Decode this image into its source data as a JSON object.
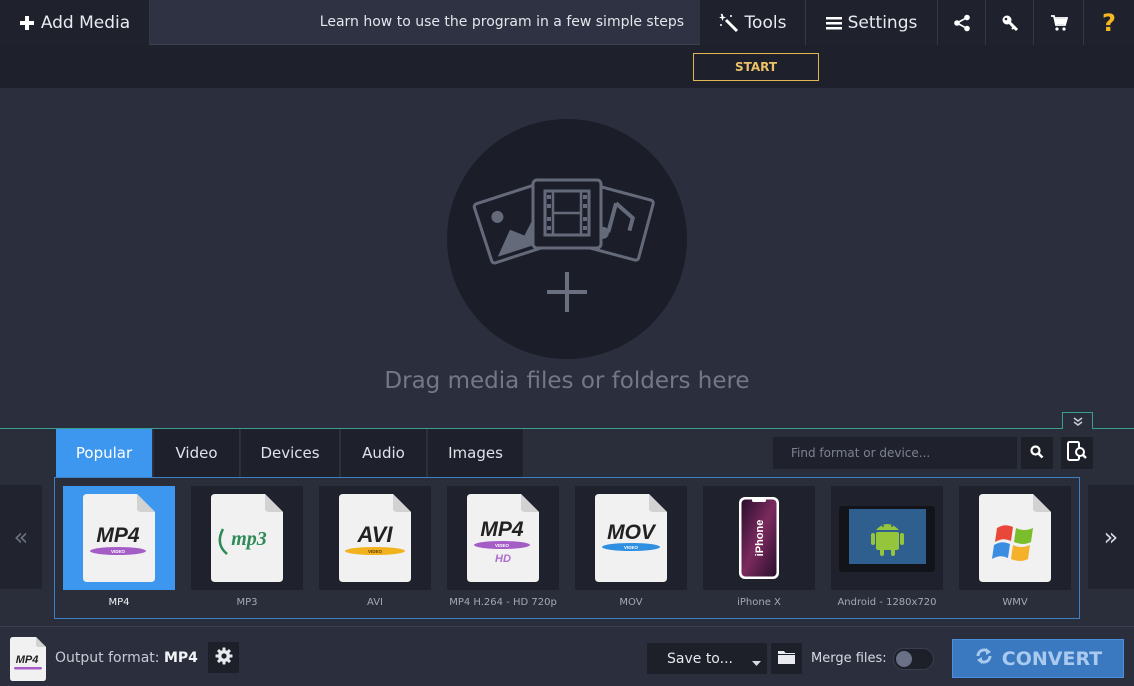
{
  "toolbar": {
    "add_media_label": "Add Media",
    "tools_label": "Tools",
    "settings_label": "Settings",
    "icons": [
      "plus-icon",
      "magic-wand-icon",
      "hamburger-menu-icon",
      "share-icon",
      "key-icon",
      "cart-icon",
      "help-icon"
    ]
  },
  "learn_bar": {
    "text": "Learn how to use the program in a few simple steps",
    "start_label": "START"
  },
  "drop_area": {
    "text": "Drag media files or folders here",
    "icons": [
      "image-icon",
      "film-icon",
      "music-icon",
      "plus-icon"
    ]
  },
  "format_panel": {
    "tabs": [
      {
        "label": "Popular",
        "active": true
      },
      {
        "label": "Video",
        "active": false
      },
      {
        "label": "Devices",
        "active": false
      },
      {
        "label": "Audio",
        "active": false
      },
      {
        "label": "Images",
        "active": false
      }
    ],
    "search": {
      "placeholder": "Find format or device...",
      "value": ""
    },
    "prev_label": "«",
    "next_label": "»",
    "presets": [
      {
        "label": "MP4",
        "icon_text": "MP4",
        "badge": "VIDEO",
        "selected": true
      },
      {
        "label": "MP3",
        "icon_text": "mp3",
        "selected": false
      },
      {
        "label": "AVI",
        "icon_text": "AVI",
        "badge": "VIDEO",
        "selected": false
      },
      {
        "label": "MP4 H.264 - HD 720p",
        "icon_text": "MP4",
        "badge": "VIDEO",
        "sub": "HD",
        "selected": false
      },
      {
        "label": "MOV",
        "icon_text": "MOV",
        "badge": "VIDEO",
        "selected": false
      },
      {
        "label": "iPhone X",
        "icon_text": "iPhone",
        "selected": false
      },
      {
        "label": "Android - 1280x720",
        "selected": false
      },
      {
        "label": "WMV",
        "selected": false
      }
    ]
  },
  "bottom_bar": {
    "output_format_label": "Output format:",
    "output_format_value": "MP4",
    "output_icon_text": "MP4",
    "save_to_label": "Save to...",
    "merge_label": "Merge files:",
    "merge_enabled": false,
    "convert_label": "CONVERT"
  },
  "colors": {
    "accent_blue": "#3d97ee",
    "start_gold": "#e0b652",
    "help_gold": "#f5b820",
    "convert_blue": "#3a78c0",
    "panel_teal": "#3a9d8f"
  }
}
